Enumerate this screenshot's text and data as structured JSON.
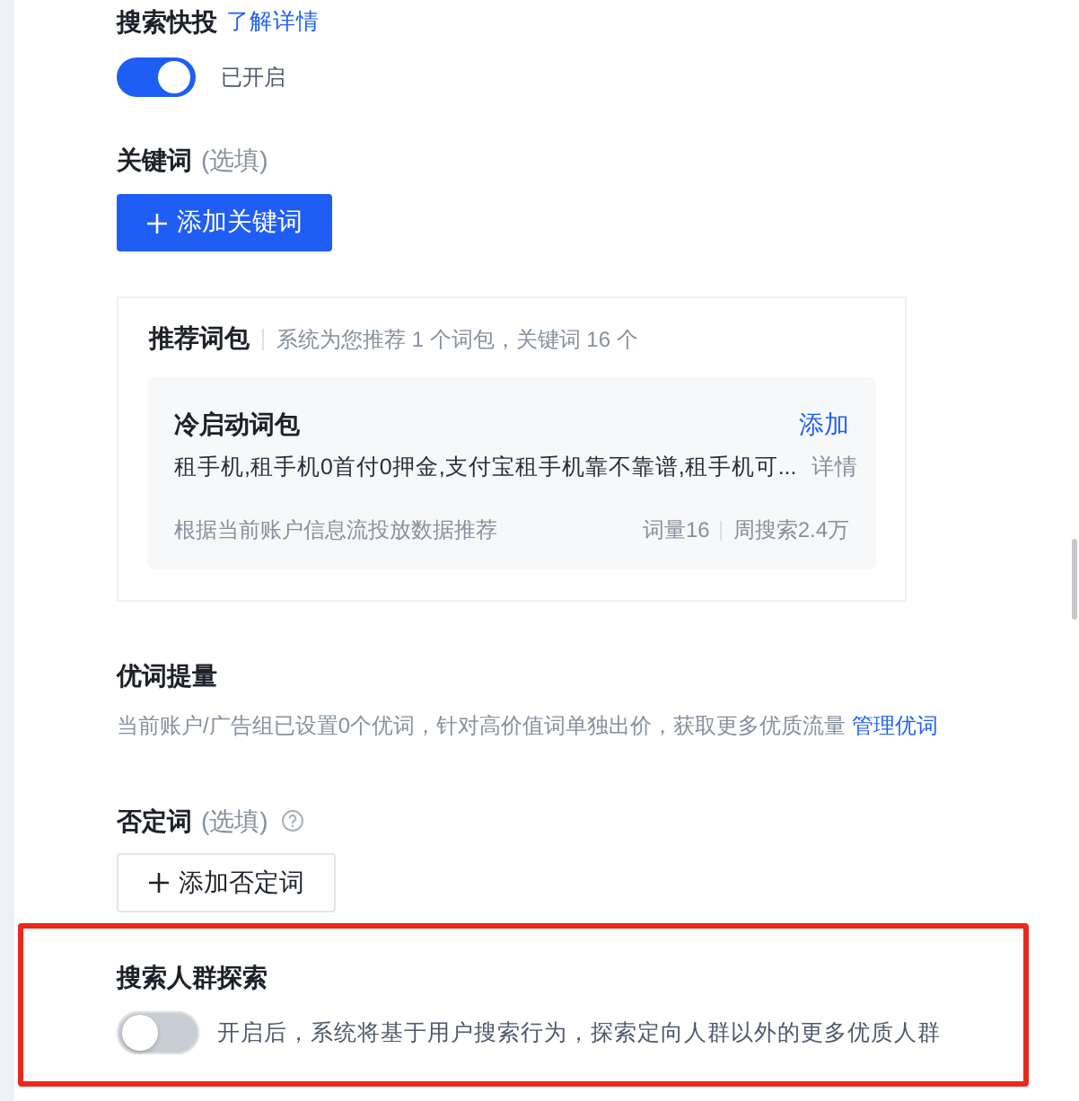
{
  "quick_search": {
    "title": "搜索快投",
    "link": "了解详情",
    "toggle": {
      "on": true,
      "label": "已开启"
    }
  },
  "keywords": {
    "title": "关键词",
    "optional": "(选填)",
    "add_button": "添加关键词"
  },
  "recommended_packs": {
    "title": "推荐词包",
    "summary": "系统为您推荐 1 个词包，关键词 16 个",
    "packs": [
      {
        "name": "冷启动词包",
        "action": "添加",
        "keywords": "租手机,租手机0首付0押金,支付宝租手机靠不靠谱,租手机可...",
        "details_link": "详情",
        "source": "根据当前账户信息流投放数据推荐",
        "word_count": "词量16",
        "weekly_searches": "周搜索2.4万"
      }
    ]
  },
  "premium_words": {
    "title": "优词提量",
    "description": "当前账户/广告组已设置0个优词，针对高价值词单独出价，获取更多优质流量",
    "link": "管理优词"
  },
  "negative_words": {
    "title": "否定词",
    "optional": "(选填)",
    "add_button": "添加否定词"
  },
  "audience_explore": {
    "title": "搜索人群探索",
    "highlighted": true,
    "toggle": {
      "on": false
    },
    "description": "开启后，系统将基于用户搜索行为，探索定向人群以外的更多优质人群"
  }
}
